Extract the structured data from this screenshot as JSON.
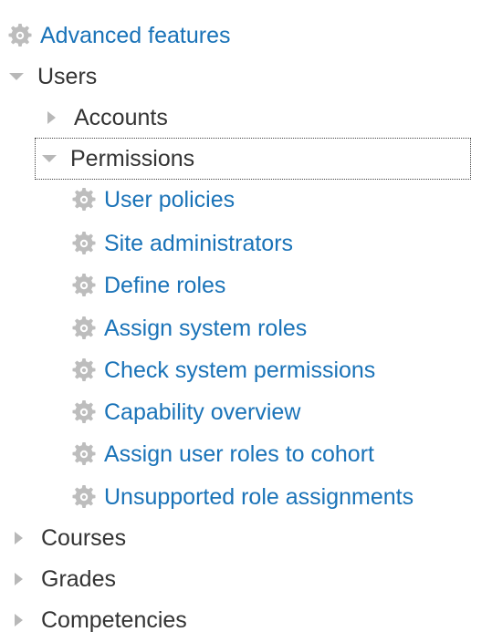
{
  "tree": {
    "advanced_features": "Advanced features",
    "users": "Users",
    "accounts": "Accounts",
    "permissions": "Permissions",
    "permissions_items": [
      "User policies",
      "Site administrators",
      "Define roles",
      "Assign system roles",
      "Check system permissions",
      "Capability overview",
      "Assign user roles to cohort",
      "Unsupported role assignments"
    ],
    "courses": "Courses",
    "grades": "Grades",
    "competencies": "Competencies"
  },
  "colors": {
    "link": "#1a73b8",
    "text": "#333333",
    "icon": "#b8b8b8"
  },
  "icons": {
    "setting": "gear-icon",
    "collapsed": "caret-right-icon",
    "expanded": "caret-down-icon"
  }
}
